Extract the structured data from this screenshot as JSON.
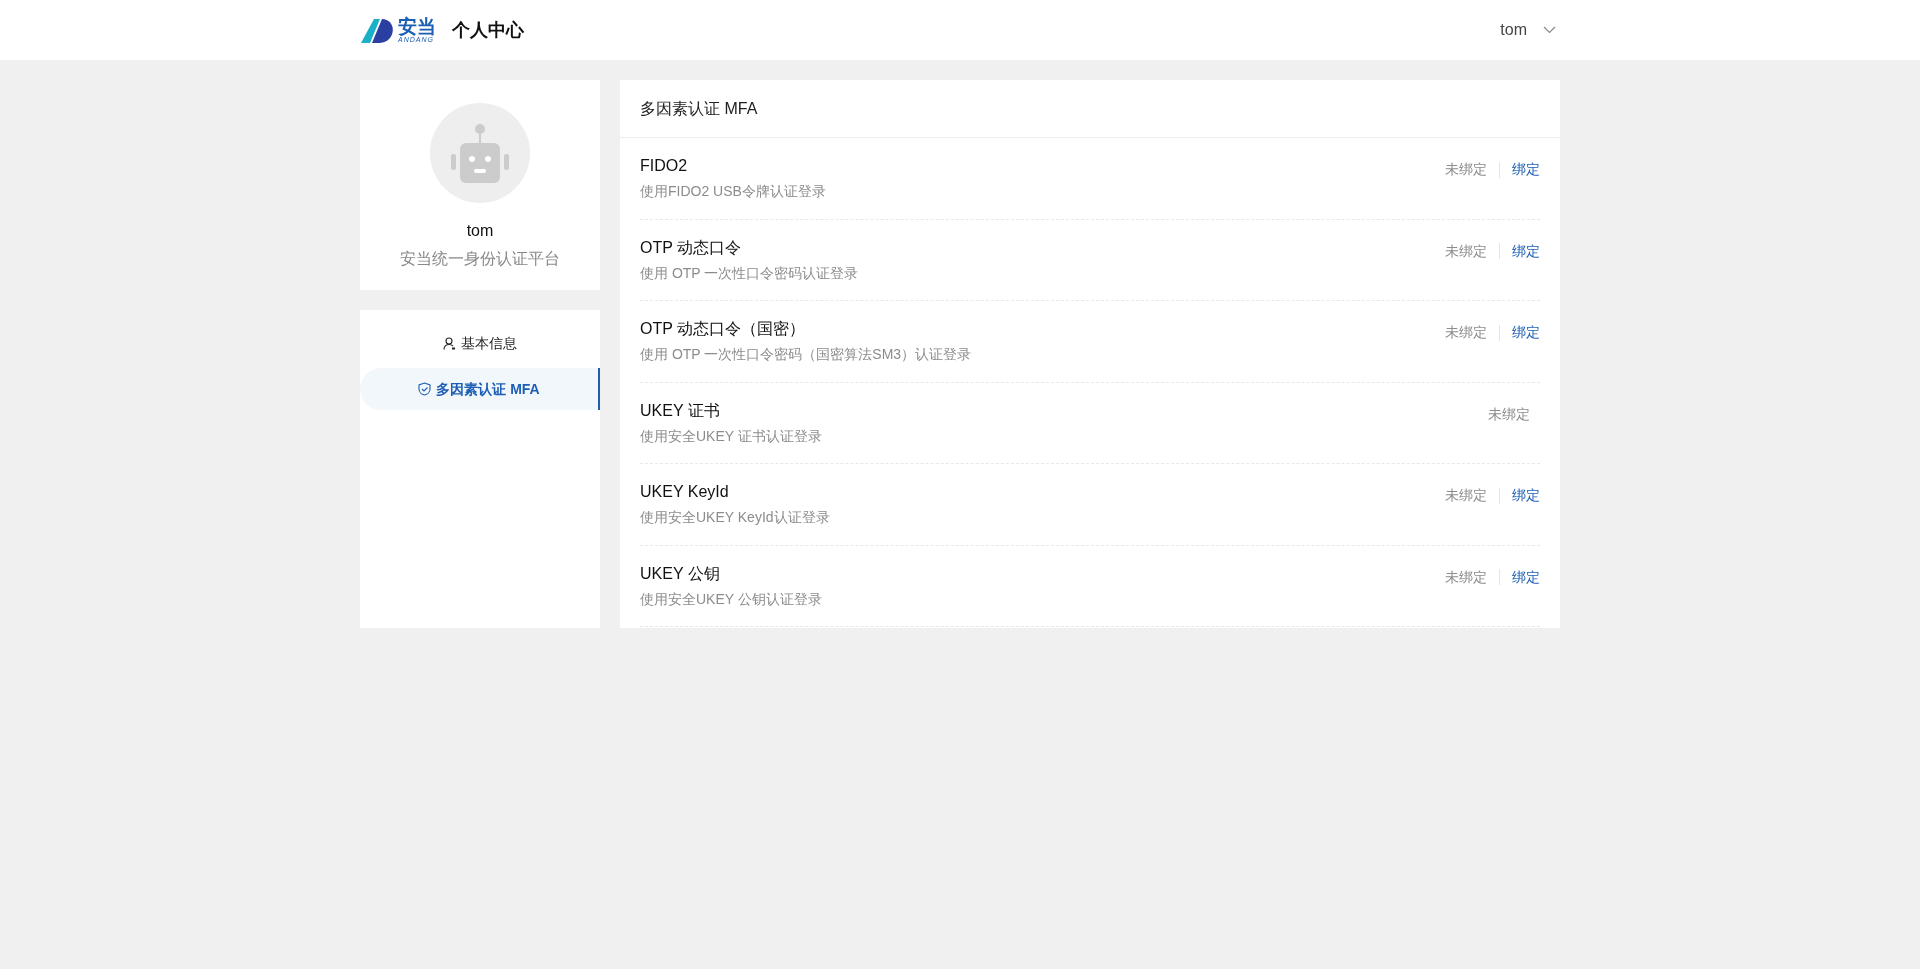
{
  "header": {
    "logo_text": "安当",
    "logo_subtext": "ANDANG",
    "title": "个人中心",
    "user": "tom"
  },
  "profile": {
    "name": "tom",
    "subtitle": "安当统一身份认证平台"
  },
  "menu": [
    {
      "label": "基本信息",
      "kind": "user",
      "selected": false
    },
    {
      "label": "多因素认证 MFA",
      "kind": "shield",
      "selected": true
    }
  ],
  "panel": {
    "title": "多因素认证 MFA",
    "methods": [
      {
        "name": "FIDO2",
        "description": "使用FIDO2 USB令牌认证登录",
        "status": "未绑定",
        "action": "绑定"
      },
      {
        "name": "OTP 动态口令",
        "description": "使用 OTP 一次性口令密码认证登录",
        "status": "未绑定",
        "action": "绑定"
      },
      {
        "name": "OTP 动态口令（国密）",
        "description": "使用 OTP 一次性口令密码（国密算法SM3）认证登录",
        "status": "未绑定",
        "action": "绑定"
      },
      {
        "name": "UKEY 证书",
        "description": "使用安全UKEY 证书认证登录",
        "status": "未绑定"
      },
      {
        "name": "UKEY KeyId",
        "description": "使用安全UKEY KeyId认证登录",
        "status": "未绑定",
        "action": "绑定"
      },
      {
        "name": "UKEY 公钥",
        "description": "使用安全UKEY 公钥认证登录",
        "status": "未绑定",
        "action": "绑定"
      }
    ]
  }
}
